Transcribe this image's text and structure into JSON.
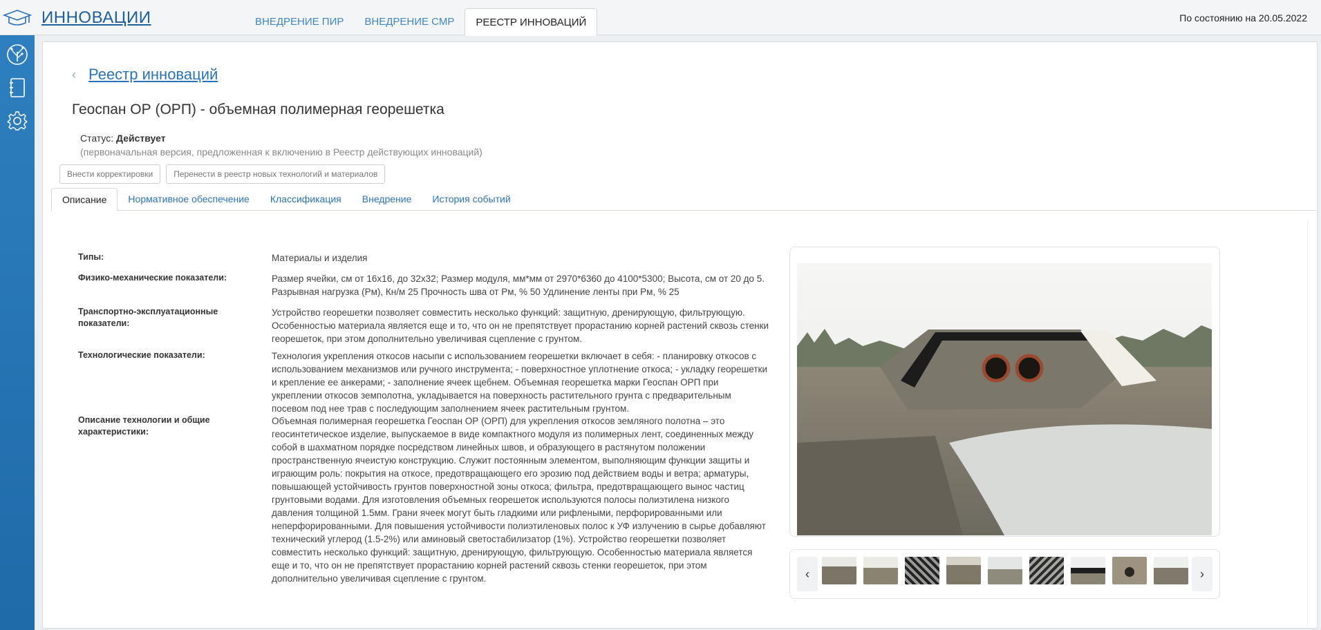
{
  "header": {
    "app_title": "ИННОВАЦИИ",
    "tabs": [
      {
        "label": "ВНЕДРЕНИЕ ПИР"
      },
      {
        "label": "ВНЕДРЕНИЕ СМР"
      },
      {
        "label": "РЕЕСТР ИННОВАЦИЙ"
      }
    ],
    "active_tab": "РЕЕСТР ИННОВАЦИЙ",
    "as_of": "По состоянию на 20.05.2022",
    "logo_icon": "graduation-cap-icon"
  },
  "sidebar": {
    "items": [
      {
        "icon": "tree-icon"
      },
      {
        "icon": "notebook-icon"
      },
      {
        "icon": "gear-icon"
      }
    ]
  },
  "breadcrumb": {
    "label": "Реестр инноваций"
  },
  "page": {
    "title": "Геоспан ОР (ОРП) - объемная полимерная георешетка",
    "status_label": "Статус:",
    "status_value": "Действует",
    "status_note": "(первоначальная версия, предложенная к включению в Реестр действующих инноваций)"
  },
  "actions": {
    "edit": "Внести корректировки",
    "move": "Перенести в реестр новых технологий и материалов"
  },
  "tabs": [
    {
      "label": "Описание"
    },
    {
      "label": "Нормативное обеспечение"
    },
    {
      "label": "Классификация"
    },
    {
      "label": "Внедрение"
    },
    {
      "label": "История событий"
    }
  ],
  "active_tab": "Описание",
  "fields": [
    {
      "label": "Типы:",
      "value": "Материалы и изделия"
    },
    {
      "label": "Физико-механические показатели:",
      "value": "Размер ячейки, см от 16х16, до 32х32; Размер модуля, мм*мм от 2970*6360 до 4100*5300; Высота, см от 20 до 5. Разрывная нагрузка (Рм), Кн/м 25 Прочность шва от Рм, % 50 Удлинение ленты при Рм, % 25"
    },
    {
      "label": "Транспортно-эксплуатационные показатели:",
      "value": "Устройство георешетки позволяет совместить несколько функций: защитную, дренирующую, фильтрующую. Особенностью материала является еще и то, что он не препятствует прорастанию корней растений сквозь стенки георешеток, при этом дополнительно увеличивая сцепление с грунтом."
    },
    {
      "label": "Технологические показатели:",
      "value": "Технология укрепления откосов насыпи с использованием георешетки включает в себя: - планировку откосов с использованием механизмов или ручного инструмента; - поверхностное уплотнение откоса; - укладку георешетки и крепление ее анкерами; - заполнение ячеек щебнем. Объемная георешетка марки Геоспан ОРП при укреплении откосов земполотна, укладывается на поверхность растительного грунта с предварительным посевом под нее трав с последующим заполнением ячеек растительным грунтом."
    },
    {
      "label": "Описание технологии и общие характеристики:",
      "value": "Объемная полимерная георешетка Геоспан ОР (ОРП) для укрепления откосов земляного полотна – это геосинтетическое изделие, выпускаемое в виде компактного модуля из полимерных лент, соединенных между собой в шахматном порядке посредством линейных швов, и образующего в растянутом положении пространственную ячеистую конструкцию. Служит постоянным элементом, выполняющим функции защиты и играющим роль: покрытия на откосе, предотвращающего его эрозию под действием воды и ветра; арматуры, повышающей устойчивость грунтов поверхностной зоны откоса; фильтра, предотвращающего вынос частиц грунтовыми водами. Для изготовления объемных георешеток используются полосы полиэтилена низкого давления толщиной 1.5мм. Грани ячеек могут быть гладкими или рифлеными, перфорированными или неперфорированными. Для повышения устойчивости полиэтиленовых полос к УФ излучению в сырье добавляют технический углерод (1.5-2%) или аминовый светостабилизатор (1%). Устройство георешетки позволяет совместить несколько функций: защитную, дренирующую, фильтрующую. Особенностью материала является еще и то, что он не препятствует прорастанию корней растений сквозь стенки георешеток, при этом дополнительно увеличивая сцепление с грунтом."
    }
  ],
  "gallery": {
    "prev": "‹",
    "next": "›",
    "thumb_count": 9
  },
  "colors": {
    "accent": "#2a73b8",
    "sidebar": "#2574b4"
  }
}
